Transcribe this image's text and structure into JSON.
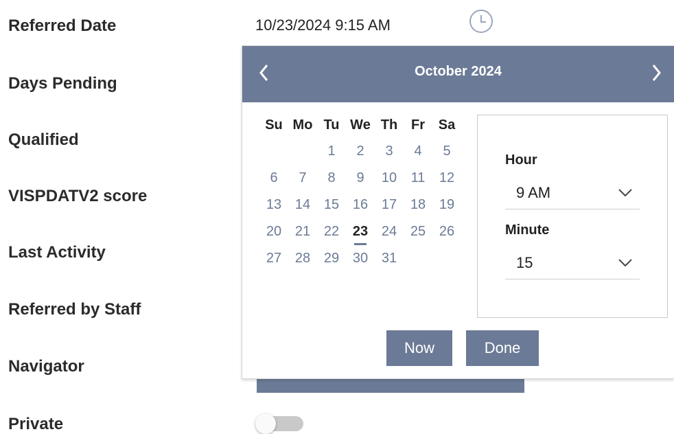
{
  "form": {
    "labels": [
      "Referred Date",
      "Days Pending",
      "Qualified",
      "VISPDATV2 score",
      "Last Activity",
      "Referred by Staff",
      "Navigator",
      "Private"
    ],
    "referred_date_value": "10/23/2024 9:15 AM",
    "clock_icon": "clock-icon",
    "private_toggle": {
      "on": false
    }
  },
  "picker": {
    "month_label": "October 2024",
    "prev_icon": "chevron-left-icon",
    "next_icon": "chevron-right-icon",
    "weekdays": [
      "Su",
      "Mo",
      "Tu",
      "We",
      "Th",
      "Fr",
      "Sa"
    ],
    "first_weekday_index": 2,
    "days": [
      "1",
      "2",
      "3",
      "4",
      "5",
      "6",
      "7",
      "8",
      "9",
      "10",
      "11",
      "12",
      "13",
      "14",
      "15",
      "16",
      "17",
      "18",
      "19",
      "20",
      "21",
      "22",
      "23",
      "24",
      "25",
      "26",
      "27",
      "28",
      "29",
      "30",
      "31"
    ],
    "selected_day": "23",
    "hour_label": "Hour",
    "hour_value": "9 AM",
    "minute_label": "Minute",
    "minute_value": "15",
    "now_button": "Now",
    "done_button": "Done",
    "accent_color": "#6b7a96"
  }
}
